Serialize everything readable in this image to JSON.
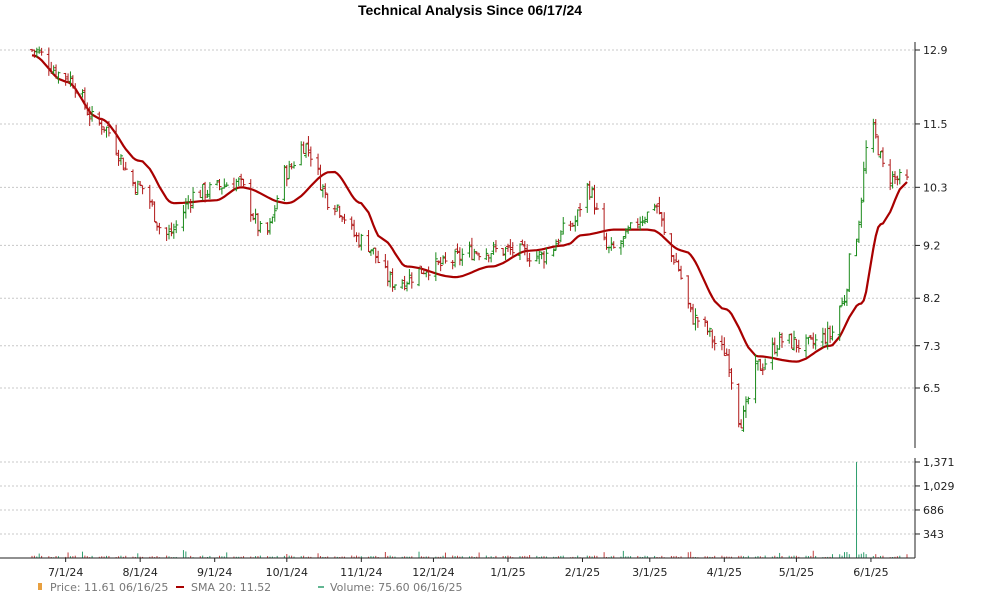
{
  "chart_data": {
    "type": "ohlc",
    "title": "Technical Analysis Since 06/17/24",
    "x_tick_labels": [
      "7/1/24",
      "8/1/24",
      "9/1/24",
      "10/1/24",
      "11/1/24",
      "12/1/24",
      "1/1/25",
      "2/1/25",
      "3/1/25",
      "4/1/25",
      "5/1/25",
      "6/1/25"
    ],
    "price_axis": {
      "ticks": [
        6.5,
        7.3,
        8.2,
        9.2,
        10.3,
        11.5,
        12.9
      ],
      "labels": [
        "6.5",
        "7.3",
        "8.2",
        "9.2",
        "10.3",
        "11.5",
        "12.9"
      ]
    },
    "volume_axis": {
      "ticks": [
        343,
        686,
        1029,
        1371
      ],
      "labels": [
        "343",
        "686",
        "1,029",
        "1,371"
      ]
    },
    "colors": {
      "up": "#1a8a1a",
      "down": "#b01818",
      "sma": "#a80000",
      "volume": "#2e9e6e",
      "volume_down": "#c44040"
    },
    "price_keypoints": [
      [
        "6/17/24",
        12.9
      ],
      [
        "7/1/24",
        12.4
      ],
      [
        "7/15/24",
        11.5
      ],
      [
        "8/1/24",
        10.3
      ],
      [
        "8/12/24",
        9.4
      ],
      [
        "8/25/24",
        10.2
      ],
      [
        "9/10/24",
        10.4
      ],
      [
        "9/22/24",
        9.4
      ],
      [
        "10/1/24",
        10.6
      ],
      [
        "10/8/24",
        11.1
      ],
      [
        "10/20/24",
        10.0
      ],
      [
        "11/1/24",
        9.3
      ],
      [
        "11/15/24",
        8.5
      ],
      [
        "12/1/24",
        8.8
      ],
      [
        "12/20/24",
        9.1
      ],
      [
        "1/1/25",
        9.1
      ],
      [
        "1/15/25",
        9.0
      ],
      [
        "1/28/25",
        9.6
      ],
      [
        "2/3/25",
        10.3
      ],
      [
        "2/12/25",
        9.1
      ],
      [
        "3/1/25",
        9.8
      ],
      [
        "3/3/25",
        10.0
      ],
      [
        "3/10/25",
        9.0
      ],
      [
        "3/20/25",
        7.8
      ],
      [
        "4/1/25",
        7.2
      ],
      [
        "4/8/25",
        5.9
      ],
      [
        "4/15/25",
        6.9
      ],
      [
        "4/25/25",
        7.4
      ],
      [
        "5/5/25",
        7.3
      ],
      [
        "5/15/25",
        7.5
      ],
      [
        "5/20/25",
        8.1
      ],
      [
        "5/25/25",
        9.3
      ],
      [
        "6/1/25",
        11.4
      ],
      [
        "6/8/25",
        10.5
      ],
      [
        "6/16/25",
        10.4
      ]
    ],
    "sma_keypoints": [
      [
        "6/17/24",
        12.8
      ],
      [
        "7/1/24",
        12.3
      ],
      [
        "7/15/24",
        11.6
      ],
      [
        "8/1/24",
        10.8
      ],
      [
        "8/15/24",
        10.0
      ],
      [
        "9/1/24",
        10.05
      ],
      [
        "9/12/24",
        10.3
      ],
      [
        "10/1/24",
        10.0
      ],
      [
        "10/20/24",
        10.6
      ],
      [
        "11/1/24",
        10.0
      ],
      [
        "11/10/24",
        9.3
      ],
      [
        "11/20/24",
        8.8
      ],
      [
        "12/10/24",
        8.6
      ],
      [
        "12/25/24",
        8.8
      ],
      [
        "1/10/25",
        9.1
      ],
      [
        "1/25/25",
        9.2
      ],
      [
        "2/1/25",
        9.4
      ],
      [
        "2/15/25",
        9.5
      ],
      [
        "3/1/25",
        9.5
      ],
      [
        "3/15/25",
        9.1
      ],
      [
        "4/1/25",
        8.0
      ],
      [
        "4/15/25",
        7.1
      ],
      [
        "5/1/25",
        7.0
      ],
      [
        "5/15/25",
        7.3
      ],
      [
        "5/28/25",
        8.1
      ],
      [
        "6/5/25",
        9.6
      ],
      [
        "6/16/25",
        10.4
      ]
    ],
    "volume_spike": {
      "date": "5/26/25",
      "value": 1371
    },
    "legend": [
      {
        "marker": "price",
        "text": "Price: 11.61  06/16/25"
      },
      {
        "marker": "sma",
        "text": "SMA 20: 11.52"
      },
      {
        "marker": "volume",
        "text": "Volume: 75.60  06/16/25"
      }
    ],
    "grid": true
  }
}
